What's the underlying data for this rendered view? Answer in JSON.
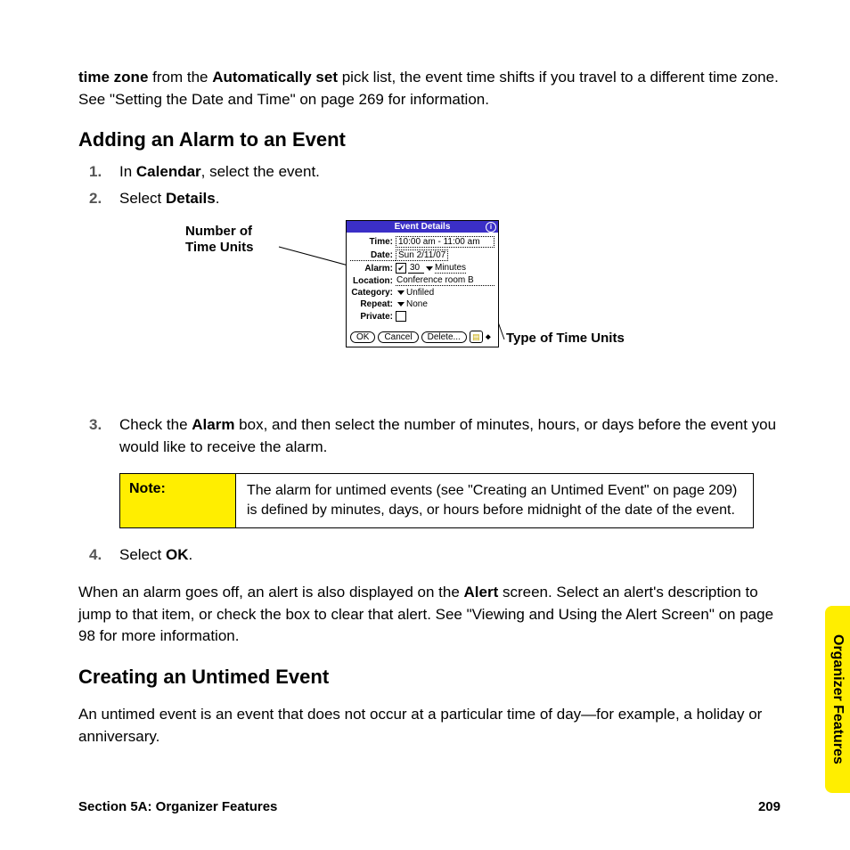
{
  "intro_fragment_html": "<b>time zone</b> from the <b>Automatically set</b> pick list, the event time shifts if you travel to a different time zone. See \"Setting the Date and Time\" on page 269 for information.",
  "section1_heading": "Adding an Alarm to an Event",
  "steps_a": [
    {
      "num": "1.",
      "html": "In <b>Calendar</b>, select the event."
    },
    {
      "num": "2.",
      "html": "Select <b>Details</b>."
    }
  ],
  "callouts": {
    "left": "Number of Time Units",
    "right": "Type of Time Units"
  },
  "palm": {
    "title": "Event Details",
    "rows": {
      "time_label": "Time:",
      "time_value": "10:00 am - 11:00 am",
      "date_label": "Date:",
      "date_value": "Sun 2/11/07",
      "alarm_label": "Alarm:",
      "alarm_num": "30",
      "alarm_unit": "Minutes",
      "location_label": "Location:",
      "location_value": "Conference room B",
      "category_label": "Category:",
      "category_value": "Unfiled",
      "repeat_label": "Repeat:",
      "repeat_value": "None",
      "private_label": "Private:"
    },
    "buttons": {
      "ok": "OK",
      "cancel": "Cancel",
      "delete": "Delete...",
      "note_glyph": "🗒"
    }
  },
  "steps_b": [
    {
      "num": "3.",
      "html": "Check the <b>Alarm</b> box, and then select the number of minutes, hours, or days before the event you would like to receive the alarm."
    }
  ],
  "note": {
    "label": "Note:",
    "text": "The alarm for untimed events (see \"Creating an Untimed Event\" on page 209) is defined by minutes, days, or hours before midnight of the date of the event."
  },
  "steps_c": [
    {
      "num": "4.",
      "html": "Select <b>OK</b>."
    }
  ],
  "para_after_html": "When an alarm goes off, an alert is also displayed on the <b>Alert</b> screen. Select an alert's description to jump to that item, or check the box to clear that alert. See \"Viewing and Using the Alert Screen\" on page 98 for more information.",
  "section2_heading": "Creating an Untimed Event",
  "section2_para": "An untimed event is an event that does not occur at a particular time of day—for example, a holiday or anniversary.",
  "side_tab": "Organizer Features",
  "footer_left": "Section 5A: Organizer Features",
  "footer_right": "209"
}
